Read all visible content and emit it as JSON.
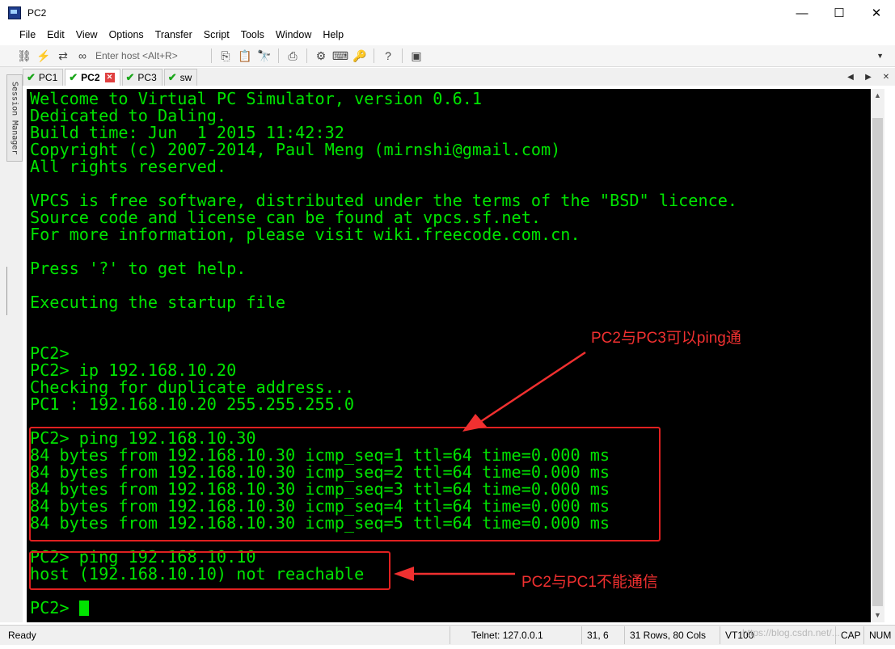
{
  "window": {
    "title": "PC2",
    "controls": {
      "minimize": "—",
      "maximize": "☐",
      "close": "✕"
    }
  },
  "menu": [
    "File",
    "Edit",
    "View",
    "Options",
    "Transfer",
    "Script",
    "Tools",
    "Window",
    "Help"
  ],
  "toolbar": {
    "host_placeholder": "Enter host <Alt+R>",
    "icons": [
      "connect-icon",
      "quick-connect-icon",
      "reconnect-icon",
      "disconnect-icon",
      "copy-icon",
      "paste-icon",
      "find-icon",
      "print-icon",
      "settings-icon",
      "keymap-icon",
      "key-icon",
      "help-icon",
      "sftp-icon"
    ]
  },
  "tabs": [
    {
      "label": "PC1",
      "active": false
    },
    {
      "label": "PC2",
      "active": true
    },
    {
      "label": "PC3",
      "active": false
    },
    {
      "label": "sw",
      "active": false
    }
  ],
  "session_manager_label": "Session Manager",
  "terminal": {
    "fg_color": "#00e400",
    "bg_color": "#000000",
    "lines": [
      "Welcome to Virtual PC Simulator, version 0.6.1",
      "Dedicated to Daling.",
      "Build time: Jun  1 2015 11:42:32",
      "Copyright (c) 2007-2014, Paul Meng (mirnshi@gmail.com)",
      "All rights reserved.",
      "",
      "VPCS is free software, distributed under the terms of the \"BSD\" licence.",
      "Source code and license can be found at vpcs.sf.net.",
      "For more information, please visit wiki.freecode.com.cn.",
      "",
      "Press '?' to get help.",
      "",
      "Executing the startup file",
      "",
      "",
      "PC2>",
      "PC2> ip 192.168.10.20",
      "Checking for duplicate address...",
      "PC1 : 192.168.10.20 255.255.255.0",
      "",
      "PC2> ping 192.168.10.30",
      "84 bytes from 192.168.10.30 icmp_seq=1 ttl=64 time=0.000 ms",
      "84 bytes from 192.168.10.30 icmp_seq=2 ttl=64 time=0.000 ms",
      "84 bytes from 192.168.10.30 icmp_seq=3 ttl=64 time=0.000 ms",
      "84 bytes from 192.168.10.30 icmp_seq=4 ttl=64 time=0.000 ms",
      "84 bytes from 192.168.10.30 icmp_seq=5 ttl=64 time=0.000 ms",
      "",
      "PC2> ping 192.168.10.10",
      "host (192.168.10.10) not reachable",
      "",
      "PC2> "
    ]
  },
  "annotations": {
    "top": "PC2与PC3可以ping通",
    "bottom": "PC2与PC1不能通信",
    "color": "#f03030"
  },
  "status": {
    "ready": "Ready",
    "connection": "Telnet: 127.0.0.1",
    "cursor_pos": "31,  6",
    "size": "31 Rows, 80 Cols",
    "emulation": "VT100",
    "caps": "CAP",
    "num": "NUM",
    "watermark": "https://blog.csdn.net/..."
  }
}
